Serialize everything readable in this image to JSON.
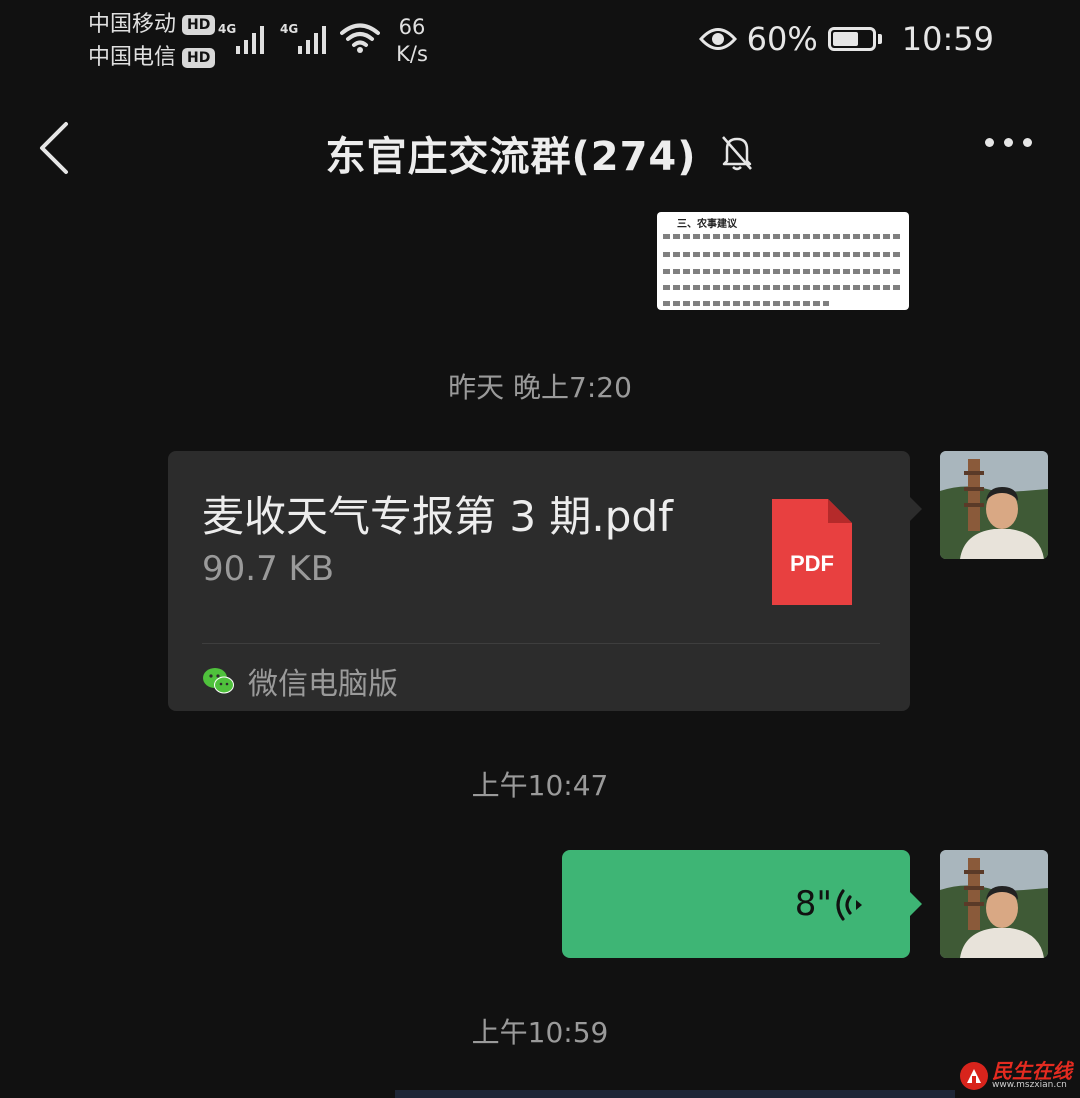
{
  "status_bar": {
    "carrier1": "中国移动",
    "carrier2": "中国电信",
    "hd_badge": "HD",
    "network_type": "4G",
    "speed_value": "66",
    "speed_unit": "K/s",
    "battery": "60%",
    "time": "10:59"
  },
  "header": {
    "title": "东官庄交流群(274)",
    "muted": true
  },
  "doc_preview": {
    "heading": "三、农事建议"
  },
  "messages": [
    {
      "timestamp": "昨天 晚上7:20",
      "type": "file",
      "file_name": "麦收天气专报第 3 期.pdf",
      "file_size": "90.7 KB",
      "file_icon_label": "PDF",
      "source": "微信电脑版"
    },
    {
      "timestamp": "上午10:47",
      "type": "voice",
      "duration": "8\""
    },
    {
      "timestamp": "上午10:59"
    }
  ],
  "watermark": {
    "name": "民生在线",
    "url": "www.mszxian.cn"
  },
  "colors": {
    "background": "#111111",
    "bubble_dark": "#2c2c2c",
    "bubble_green": "#3eb575",
    "pdf_red": "#e84040",
    "wechat_green": "#4fc13c"
  }
}
